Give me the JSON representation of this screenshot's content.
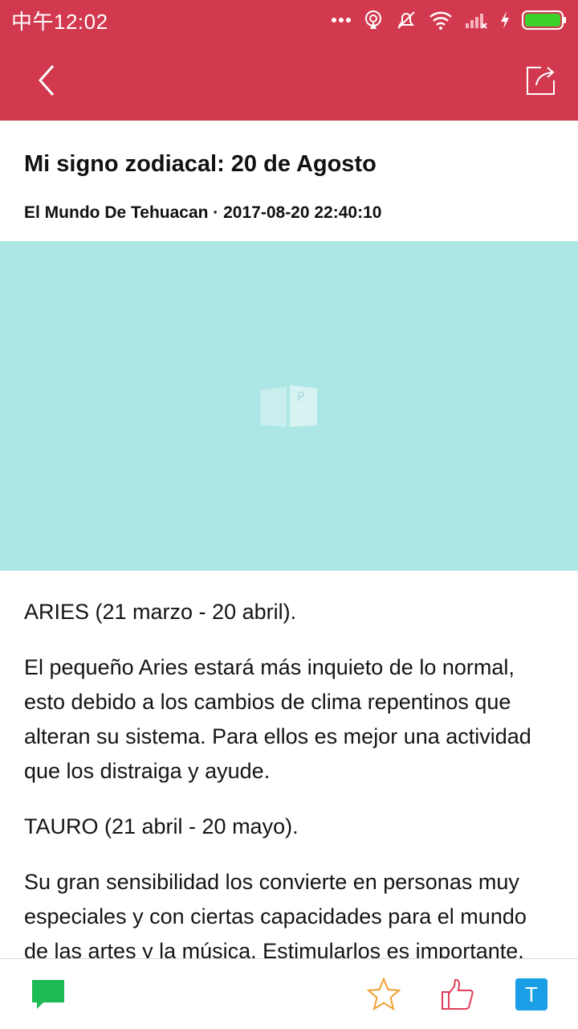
{
  "status_bar": {
    "time": "中午12:02"
  },
  "colors": {
    "brand": "#d2394f",
    "image_placeholder": "#ace7e6",
    "comment": "#1db954",
    "star": "#f0a030",
    "like": "#e0405a",
    "translate": "#1a9ee6"
  },
  "article": {
    "title": "Mi signo zodiacal: 20 de Agosto",
    "byline": "El Mundo De Tehuacan · 2017-08-20 22:40:10",
    "paragraphs": [
      "ARIES (21 marzo - 20 abril).",
      "El pequeño Aries estará más inquieto de lo normal, esto debido a los cambios de clima repentinos que alteran su sistema. Para ellos es mejor una actividad que los distraiga y ayude.",
      "TAURO (21 abril - 20 mayo).",
      "Su gran sensibilidad los convierte en personas muy especiales y con ciertas capacidades para el mundo de las artes y la música. Estimularlos es importante."
    ]
  },
  "bottom_bar": {
    "translate_label": "T"
  },
  "icons": [
    "back-icon",
    "share-icon",
    "image-placeholder-icon",
    "comment-icon",
    "star-icon",
    "like-icon",
    "translate-icon"
  ]
}
